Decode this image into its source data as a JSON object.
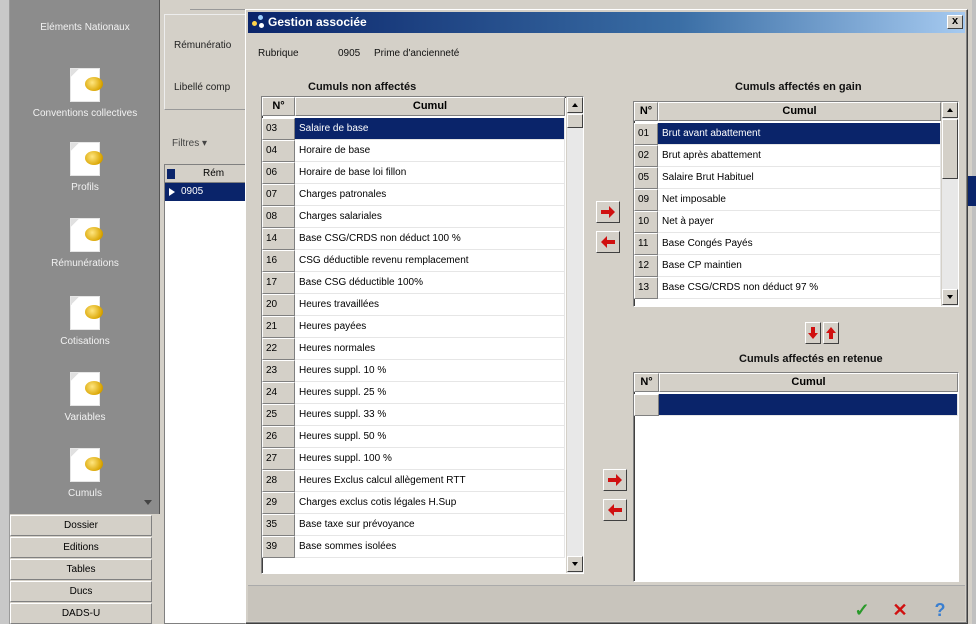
{
  "sidebar": {
    "items": [
      {
        "label": "Eléments Nationaux"
      },
      {
        "label": "Conventions collectives"
      },
      {
        "label": "Profils"
      },
      {
        "label": "Rémunérations"
      },
      {
        "label": "Cotisations"
      },
      {
        "label": "Variables"
      },
      {
        "label": "Cumuls"
      }
    ],
    "bottom_buttons": [
      "Dossier",
      "Editions",
      "Tables",
      "Ducs",
      "DADS-U"
    ]
  },
  "background_form": {
    "label_remuneration": "Rémunératio",
    "label_libelle": "Libellé comp",
    "filter_label": "Filtres",
    "grid_header": "Rém",
    "selected_row": "0905"
  },
  "dialog": {
    "title": "Gestion associée",
    "close_label": "x",
    "rubrique_label": "Rubrique",
    "rubrique_code": "0905",
    "rubrique_name": "Prime d'ancienneté",
    "unassigned": {
      "title": "Cumuls non affectés",
      "col_num": "N°",
      "col_name": "Cumul",
      "rows": [
        {
          "num": "03",
          "name": "Salaire de base",
          "selected": true
        },
        {
          "num": "04",
          "name": "Horaire de base"
        },
        {
          "num": "06",
          "name": "Horaire de base loi fillon"
        },
        {
          "num": "07",
          "name": "Charges patronales"
        },
        {
          "num": "08",
          "name": "Charges salariales"
        },
        {
          "num": "14",
          "name": "Base CSG/CRDS non déduct 100 %"
        },
        {
          "num": "16",
          "name": "CSG déductible revenu remplacement"
        },
        {
          "num": "17",
          "name": "Base CSG déductible 100%"
        },
        {
          "num": "20",
          "name": "Heures travaillées"
        },
        {
          "num": "21",
          "name": "Heures payées"
        },
        {
          "num": "22",
          "name": "Heures normales"
        },
        {
          "num": "23",
          "name": "Heures suppl. 10 %"
        },
        {
          "num": "24",
          "name": "Heures suppl. 25 %"
        },
        {
          "num": "25",
          "name": "Heures suppl. 33 %"
        },
        {
          "num": "26",
          "name": "Heures suppl. 50 %"
        },
        {
          "num": "27",
          "name": "Heures suppl. 100 %"
        },
        {
          "num": "28",
          "name": "Heures Exclus calcul allègement RTT"
        },
        {
          "num": "29",
          "name": "Charges exclus cotis légales H.Sup"
        },
        {
          "num": "35",
          "name": "Base taxe sur prévoyance"
        },
        {
          "num": "39",
          "name": "Base sommes isolées"
        }
      ]
    },
    "gain": {
      "title": "Cumuls affectés en gain",
      "col_num": "N°",
      "col_name": "Cumul",
      "rows": [
        {
          "num": "01",
          "name": "Brut avant abattement",
          "selected": true
        },
        {
          "num": "02",
          "name": "Brut après abattement"
        },
        {
          "num": "05",
          "name": "Salaire Brut Habituel"
        },
        {
          "num": "09",
          "name": "Net imposable"
        },
        {
          "num": "10",
          "name": "Net à payer"
        },
        {
          "num": "11",
          "name": "Base Congés Payés"
        },
        {
          "num": "12",
          "name": "Base CP maintien"
        },
        {
          "num": "13",
          "name": "Base CSG/CRDS non déduct 97 %"
        }
      ]
    },
    "retenue": {
      "title": "Cumuls affectés en retenue",
      "col_num": "N°",
      "col_name": "Cumul",
      "rows": [
        {
          "num": "",
          "name": "",
          "selected": true
        }
      ]
    },
    "footer": {
      "ok": "✓",
      "cancel": "✕",
      "help": "?"
    }
  },
  "colors": {
    "selection": "#0a246a",
    "arrow": "#d01010",
    "ok": "#2a9a2a",
    "cancel": "#d01010",
    "help": "#3a7fd0"
  }
}
